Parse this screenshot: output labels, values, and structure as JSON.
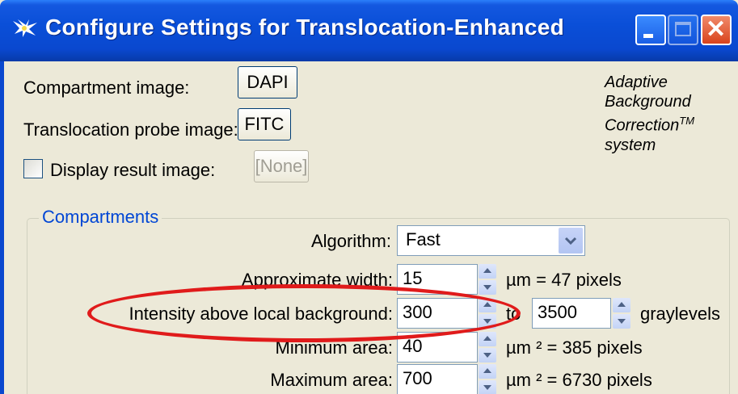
{
  "window": {
    "title": "Configure Settings for Translocation-Enhanced",
    "controls": {
      "minimize": "minimize-icon",
      "maximize": "maximize-icon",
      "close": "close-icon"
    }
  },
  "images": {
    "compartment_label": "Compartment image:",
    "compartment_button": "DAPI",
    "probe_label": "Translocation probe image:",
    "probe_button": "FITC",
    "display_label": "Display result image:",
    "display_checked": false,
    "display_button": "[None]"
  },
  "branding": {
    "line1": "Adaptive",
    "line2": "Background",
    "line3": "Correction",
    "tm": "TM",
    "line4": "system"
  },
  "compartments": {
    "title": "Compartments",
    "algorithm_label": "Algorithm:",
    "algorithm_value": "Fast",
    "approx_width_label": "Approximate width:",
    "approx_width_value": "15",
    "approx_width_unit": "µm = 47 pixels",
    "intensity_label": "Intensity above local background:",
    "intensity_low": "300",
    "intensity_to": "to",
    "intensity_high": "3500",
    "intensity_unit": "graylevels",
    "min_area_label": "Minimum area:",
    "min_area_value": "40",
    "min_area_unit": "µm ² = 385 pixels",
    "max_area_label": "Maximum area:",
    "max_area_value": "700",
    "max_area_unit": "µm ² = 6730 pixels"
  },
  "colors": {
    "titlebar": "#0a48cf",
    "highlight": "#e01b1b",
    "group_title": "#0046d5"
  }
}
